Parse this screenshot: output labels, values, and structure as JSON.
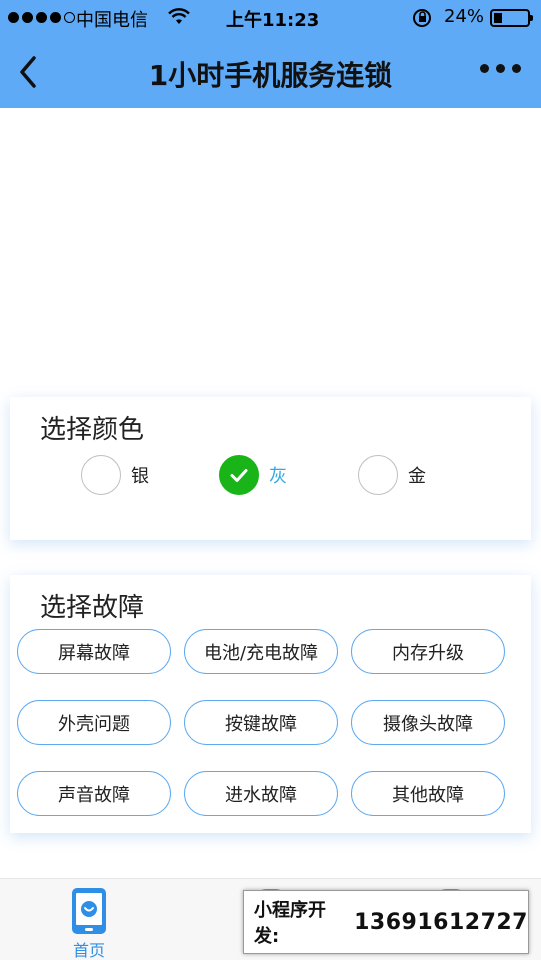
{
  "status_bar": {
    "carrier": "中国电信",
    "time": "上午11:23",
    "battery": "24%"
  },
  "nav": {
    "title": "1小时手机服务连锁"
  },
  "colors": {
    "title": "选择颜色",
    "options": [
      {
        "label": "银",
        "selected": false
      },
      {
        "label": "灰",
        "selected": true
      },
      {
        "label": "金",
        "selected": false
      }
    ]
  },
  "faults": {
    "title": "选择故障",
    "items": [
      "屏幕故障",
      "电池/充电故障",
      "内存升级",
      "外壳问题",
      "按键故障",
      "摄像头故障",
      "声音故障",
      "进水故障",
      "其他故障"
    ]
  },
  "tab_bar": {
    "home_label": "首页"
  },
  "promo": {
    "label": "小程序开发:",
    "phone": "13691612727"
  },
  "theme": {
    "header_color": "#5eaaf6",
    "check_color": "#18b418",
    "button_border": "#5fa9ee"
  }
}
